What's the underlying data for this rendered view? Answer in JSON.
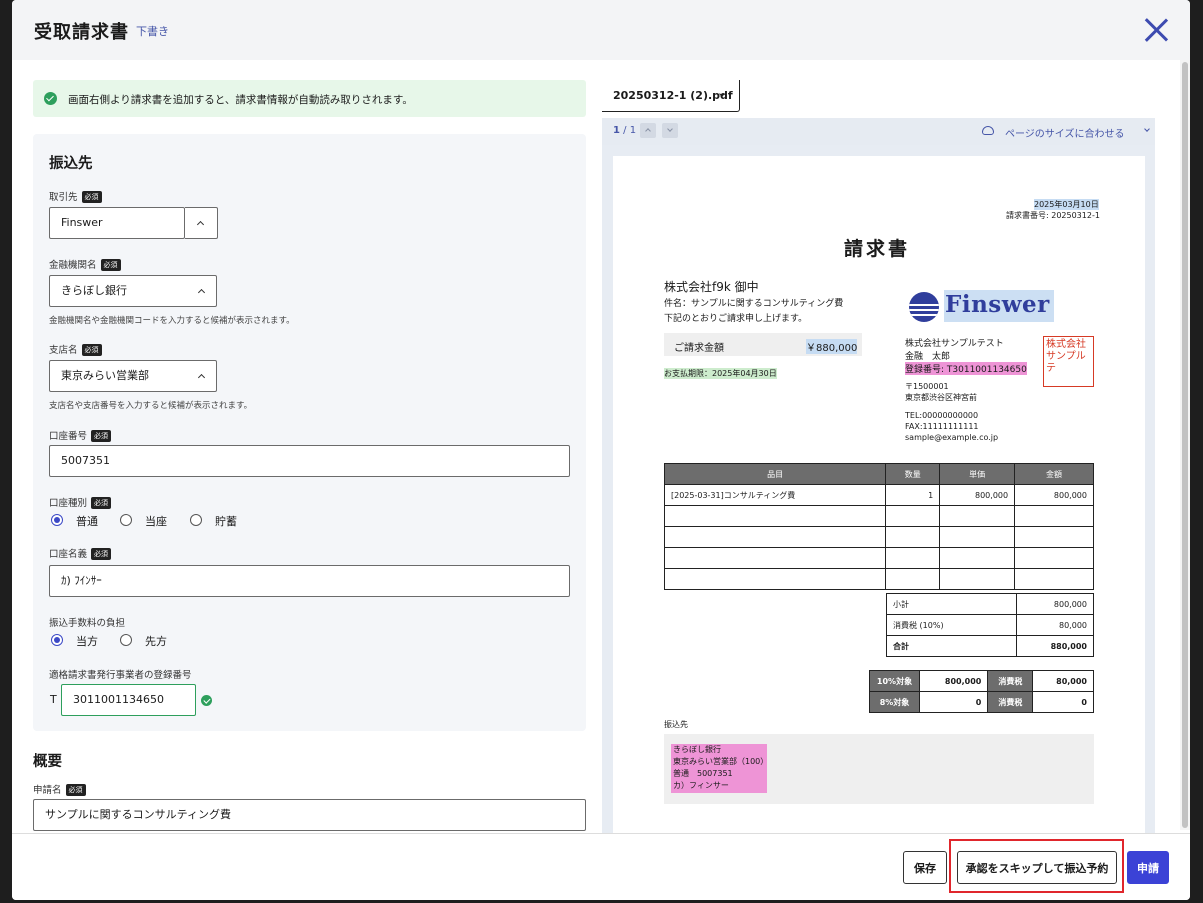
{
  "header": {
    "title": "受取請求書",
    "status": "下書き"
  },
  "notice": "画面右側より請求書を追加すると、請求書情報が自動読み取りされます。",
  "payee": {
    "section_title": "振込先",
    "required_badge": "必須",
    "partner": {
      "label": "取引先",
      "value": "Finswer"
    },
    "bank": {
      "label": "金融機関名",
      "value": "きらぼし銀行",
      "help": "金融機関名や金融機関コードを入力すると候補が表示されます。"
    },
    "branch": {
      "label": "支店名",
      "value": "東京みらい営業部",
      "help": "支店名や支店番号を入力すると候補が表示されます。"
    },
    "account_number": {
      "label": "口座番号",
      "value": "5007351"
    },
    "account_type": {
      "label": "口座種別",
      "options": [
        "普通",
        "当座",
        "貯蓄"
      ],
      "selected": "普通"
    },
    "account_name": {
      "label": "口座名義",
      "value": "ｶ) ﾌｲﾝｻｰ"
    },
    "fee": {
      "label": "振込手数料の負担",
      "options": [
        "当方",
        "先方"
      ],
      "selected": "当方"
    },
    "registration": {
      "label": "適格請求書発行事業者の登録番号",
      "prefix": "T",
      "value": "3011001134650"
    }
  },
  "summary": {
    "section_title": "概要",
    "application_name": {
      "label": "申請名",
      "value": "サンプルに関するコンサルティング費"
    }
  },
  "viewer": {
    "filename": "20250312-1 (2).pdf",
    "page_current": "1",
    "page_sep": " / 1",
    "fit_label": "ページのサイズに合わせる"
  },
  "invoice": {
    "date": "2025年03月10日",
    "number": "請求書番号: 20250312-1",
    "title": "請求書",
    "recipient": "株式会社f9k 御中",
    "subject": "件名：サンプルに関するコンサルティング費",
    "intro": "下記のとおりご請求申し上げます。",
    "amount_label": "ご請求金額",
    "amount_value": "￥880,000",
    "due": "お支払期限：2025年04月30日",
    "logo_text": "Finswer",
    "issuer": "株式会社サンプルテスト",
    "person": "金融　太郎",
    "reg_no": "登録番号: T3011001134650",
    "postal": "〒1500001",
    "address": "東京都渋谷区神宮前",
    "tel": "TEL:00000000000",
    "fax": "FAX:11111111111",
    "email": "sample@example.co.jp",
    "seal": "株式会社サンプルテ",
    "table_headers": [
      "品目",
      "数量",
      "単価",
      "金額"
    ],
    "row1": [
      "[2025-03-31]コンサルティング費",
      "1",
      "800,000",
      "800,000"
    ],
    "subtotal_label": "小計",
    "subtotal": "800,000",
    "tax_label": "消費税 (10%)",
    "tax": "80,000",
    "total_label": "合計",
    "total": "880,000",
    "rate10_label": "10%対象",
    "rate10_amount": "800,000",
    "rate10_tax_label": "消費税",
    "rate10_tax": "80,000",
    "rate8_label": "8%対象",
    "rate8_amount": "0",
    "rate8_tax_label": "消費税",
    "rate8_tax": "0",
    "bank_heading": "振込先",
    "bank_lines": [
      "きらぼし銀行",
      "東京みらい営業部（100）",
      "普通　5007351",
      "カ）フィンサー"
    ]
  },
  "footer": {
    "save": "保存",
    "skip": "承認をスキップして振込予約",
    "apply": "申請"
  }
}
